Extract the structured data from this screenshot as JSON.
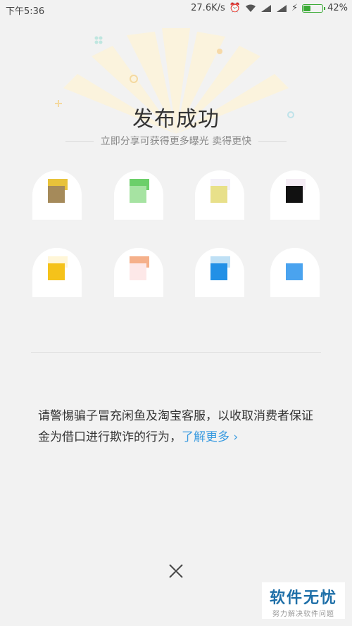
{
  "status": {
    "time": "下午5:36",
    "speed": "27.6K/s",
    "battery": "42%",
    "battery_level": 0.42
  },
  "title": "发布成功",
  "subtitle": "立即分享可获得更多曝光 卖得更快",
  "share_targets": [
    {
      "icon": "share-target-icon-1",
      "color": "#a58a5a",
      "accent": "#e8c23a"
    },
    {
      "icon": "share-target-icon-2",
      "color": "#a6e3a2",
      "accent": "#6ccf6a"
    },
    {
      "icon": "share-target-icon-3",
      "color": "#e8e08a",
      "accent": "#f3f0f8"
    },
    {
      "icon": "share-target-icon-4",
      "color": "#111111",
      "accent": "#f4ecf4"
    },
    {
      "icon": "share-target-icon-5",
      "color": "#f5c21a",
      "accent": "#fff6d8"
    },
    {
      "icon": "share-target-icon-6",
      "color": "#fde8e8",
      "accent": "#f5b08a"
    },
    {
      "icon": "share-target-icon-7",
      "color": "#2290e6",
      "accent": "#bfe0f5"
    },
    {
      "icon": "share-target-icon-8",
      "color": "#4aa3ef",
      "accent": "#ffffff"
    }
  ],
  "warning_text": "请警惕骗子冒充闲鱼及淘宝客服，以收取消费者保证金为借口进行欺诈的行为，",
  "learn_more": "了解更多",
  "watermark": {
    "title": "软件无忧",
    "subtitle": "努力解决软件问题"
  }
}
